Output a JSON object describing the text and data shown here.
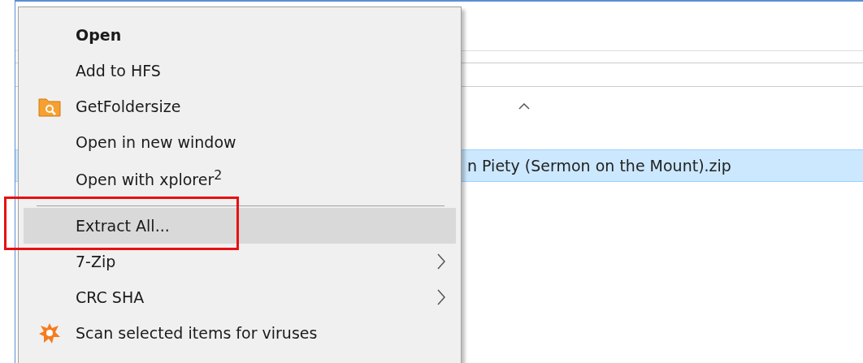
{
  "file_row": {
    "name": "n Piety (Sermon on the Mount).zip",
    "selected": true
  },
  "context_menu": {
    "items": [
      {
        "kind": "default",
        "label": "Open",
        "highlighted": false
      },
      {
        "kind": "item",
        "label": "Add to HFS",
        "highlighted": false
      },
      {
        "kind": "folder-item",
        "label": "GetFoldersize",
        "highlighted": false
      },
      {
        "kind": "item",
        "label": "Open in new window",
        "highlighted": false
      },
      {
        "kind": "item",
        "label": "Open with xplorer$^{2}$",
        "highlighted": false
      },
      {
        "kind": "separator"
      },
      {
        "kind": "item",
        "label": "Extract All...",
        "highlighted": true
      },
      {
        "kind": "submenu",
        "label": "7-Zip",
        "highlighted": false
      },
      {
        "kind": "submenu",
        "label": "CRC SHA",
        "highlighted": false
      },
      {
        "kind": "scan-item",
        "label": "Scan selected items for viruses",
        "highlighted": false
      }
    ]
  }
}
